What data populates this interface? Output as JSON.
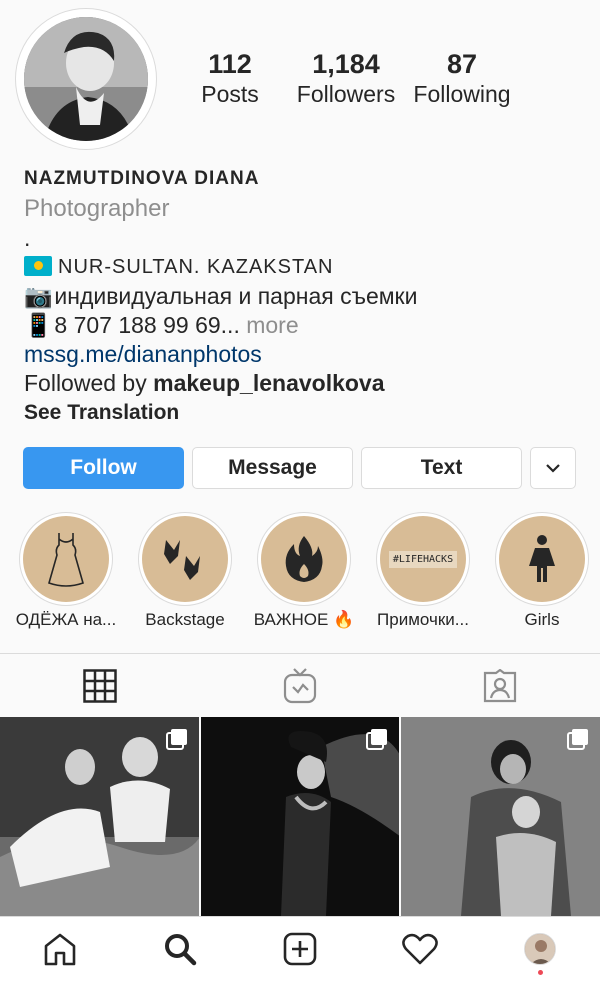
{
  "profile": {
    "name": "NAZMUTDINOVA DIANA",
    "category": "Photographer",
    "bio_dot": ".",
    "location": "NUR-SULTAN. KAZAKSTAN",
    "bio_line_1": "индивидуальная и парная съемки",
    "phone": "8 707 188 99 69",
    "ellipsis": "...",
    "more": "more",
    "link": "mssg.me/diananphotos",
    "followed_by_prefix": "Followed by ",
    "followed_by_user": "makeup_lenavolkova",
    "see_translation": "See Translation",
    "flag_icon": "kazakhstan-flag",
    "camera_emoji": "📷",
    "phone_emoji": "📱"
  },
  "stats": [
    {
      "value": "112",
      "label": "Posts"
    },
    {
      "value": "1,184",
      "label": "Followers"
    },
    {
      "value": "87",
      "label": "Following"
    }
  ],
  "buttons": {
    "follow": "Follow",
    "message": "Message",
    "text": "Text"
  },
  "highlights": [
    {
      "label": "ОДЁЖА на...",
      "icon": "dress-icon"
    },
    {
      "label": "Backstage",
      "icon": "footprints-icon"
    },
    {
      "label": "ВАЖНОЕ 🔥",
      "icon": "fire-icon"
    },
    {
      "label": "Примочки...",
      "icon": "lifehacks-badge",
      "badge_text": "#LIFEHACKS"
    },
    {
      "label": "Girls",
      "icon": "woman-icon"
    }
  ],
  "tabs": [
    "grid-icon",
    "igtv-icon",
    "tagged-icon"
  ],
  "nav": [
    "home-icon",
    "search-icon",
    "new-post-icon",
    "activity-icon",
    "profile-avatar"
  ],
  "colors": {
    "accent": "#3897f0",
    "link": "#00376b",
    "highlight_bg": "#d8bc96",
    "notification_dot": "#ed4956"
  }
}
